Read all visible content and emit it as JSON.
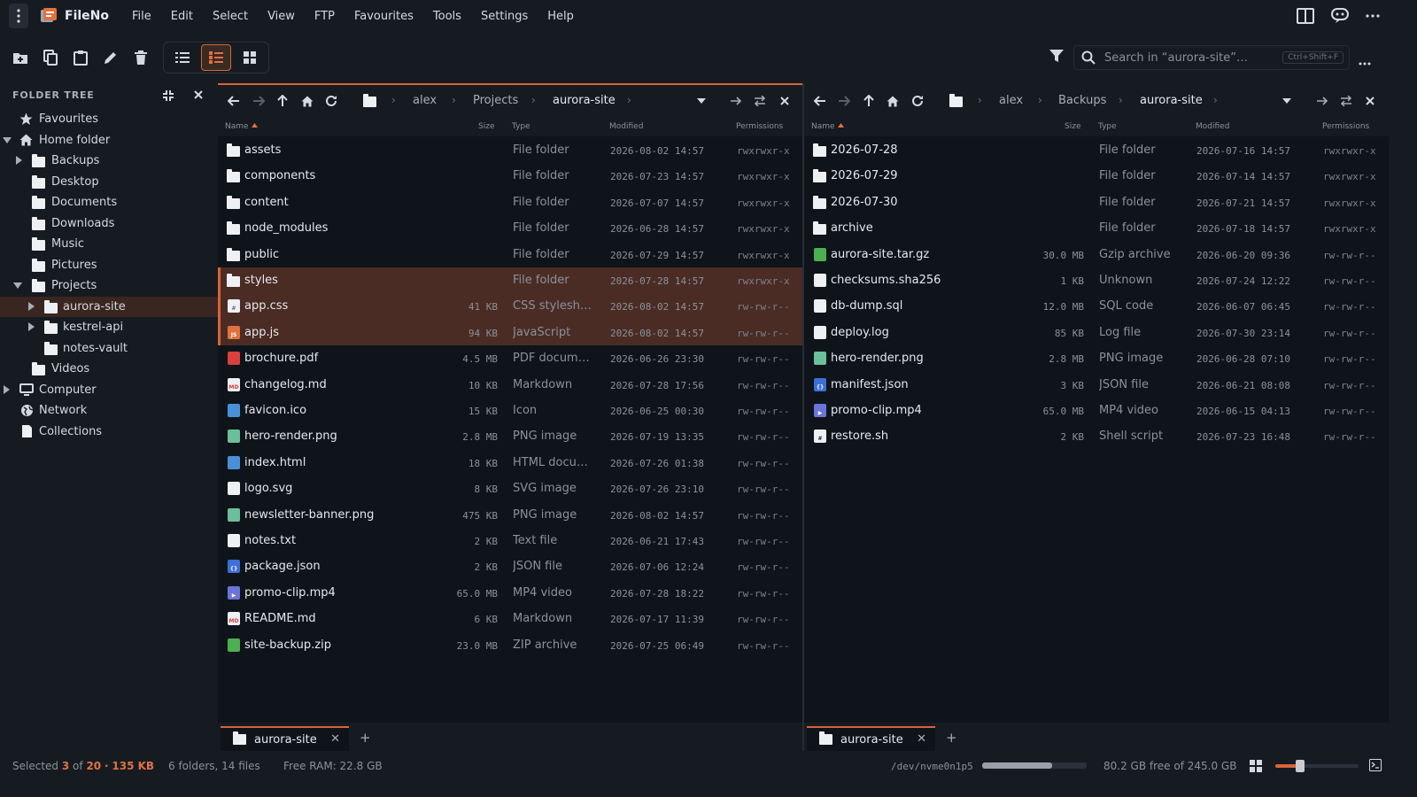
{
  "app": {
    "name": "FileNo",
    "accent": "#d8643a"
  },
  "menu": [
    "File",
    "Edit",
    "Select",
    "View",
    "FTP",
    "Favourites",
    "Tools",
    "Settings",
    "Help"
  ],
  "search": {
    "placeholder": "Search in “aurora-site”…",
    "shortcut": "Ctrl+Shift+F"
  },
  "sidebar": {
    "title": "FOLDER TREE",
    "items": [
      {
        "label": "Favourites",
        "icon": "star-icon"
      },
      {
        "label": "Home folder",
        "icon": "home-icon",
        "expanded": true
      },
      {
        "label": "Backups",
        "icon": "folder-icon"
      },
      {
        "label": "Desktop",
        "icon": "folder-icon"
      },
      {
        "label": "Documents",
        "icon": "folder-icon"
      },
      {
        "label": "Downloads",
        "icon": "folder-icon"
      },
      {
        "label": "Music",
        "icon": "folder-icon"
      },
      {
        "label": "Pictures",
        "icon": "folder-icon"
      },
      {
        "label": "Projects",
        "icon": "folder-icon",
        "expanded": true
      },
      {
        "label": "aurora-site",
        "icon": "folder-icon",
        "selected": true
      },
      {
        "label": "kestrel-api",
        "icon": "folder-icon"
      },
      {
        "label": "notes-vault",
        "icon": "folder-icon"
      },
      {
        "label": "Videos",
        "icon": "folder-icon"
      },
      {
        "label": "Computer",
        "icon": "monitor-icon"
      },
      {
        "label": "Network",
        "icon": "globe-icon"
      },
      {
        "label": "Collections",
        "icon": "document-icon"
      }
    ]
  },
  "columns": {
    "name": "Name",
    "size": "Size",
    "type": "Type",
    "modified": "Modified",
    "permissions": "Permissions"
  },
  "left_pane": {
    "breadcrumb": [
      "alex",
      "Projects",
      "aurora-site"
    ],
    "tab": "aurora-site",
    "files": [
      {
        "name": "assets",
        "size": "",
        "type": "File folder",
        "modified": "2026-08-02 14:57",
        "perm": "rwxrwxr-x",
        "icon": "folder"
      },
      {
        "name": "components",
        "size": "",
        "type": "File folder",
        "modified": "2026-07-23 14:57",
        "perm": "rwxrwxr-x",
        "icon": "folder"
      },
      {
        "name": "content",
        "size": "",
        "type": "File folder",
        "modified": "2026-07-07 14:57",
        "perm": "rwxrwxr-x",
        "icon": "folder"
      },
      {
        "name": "node_modules",
        "size": "",
        "type": "File folder",
        "modified": "2026-06-28 14:57",
        "perm": "rwxrwxr-x",
        "icon": "folder"
      },
      {
        "name": "public",
        "size": "",
        "type": "File folder",
        "modified": "2026-07-29 14:57",
        "perm": "rwxrwxr-x",
        "icon": "folder"
      },
      {
        "name": "styles",
        "size": "",
        "type": "File folder",
        "modified": "2026-07-28 14:57",
        "perm": "rwxrwxr-x",
        "icon": "folder",
        "selected": true
      },
      {
        "name": "app.css",
        "size": "41 KB",
        "type": "CSS stylesheet",
        "modified": "2026-08-02 14:57",
        "perm": "rw-rw-r--",
        "icon": "css",
        "selected": true
      },
      {
        "name": "app.js",
        "size": "94 KB",
        "type": "JavaScript",
        "modified": "2026-08-02 14:57",
        "perm": "rw-rw-r--",
        "icon": "js",
        "selected": true
      },
      {
        "name": "brochure.pdf",
        "size": "4.5 MB",
        "type": "PDF document",
        "modified": "2026-06-26 23:30",
        "perm": "rw-rw-r--",
        "icon": "pdf"
      },
      {
        "name": "changelog.md",
        "size": "10 KB",
        "type": "Markdown",
        "modified": "2026-07-28 17:56",
        "perm": "rw-rw-r--",
        "icon": "md"
      },
      {
        "name": "favicon.ico",
        "size": "15 KB",
        "type": "Icon",
        "modified": "2026-06-25 00:30",
        "perm": "rw-rw-r--",
        "icon": "image"
      },
      {
        "name": "hero-render.png",
        "size": "2.8 MB",
        "type": "PNG image",
        "modified": "2026-07-19 13:35",
        "perm": "rw-rw-r--",
        "icon": "png"
      },
      {
        "name": "index.html",
        "size": "18 KB",
        "type": "HTML docum…",
        "modified": "2026-07-26 01:38",
        "perm": "rw-rw-r--",
        "icon": "html"
      },
      {
        "name": "logo.svg",
        "size": "8 KB",
        "type": "SVG image",
        "modified": "2026-07-26 23:10",
        "perm": "rw-rw-r--",
        "icon": "svg"
      },
      {
        "name": "newsletter-banner.png",
        "size": "475 KB",
        "type": "PNG image",
        "modified": "2026-08-02 14:57",
        "perm": "rw-rw-r--",
        "icon": "png"
      },
      {
        "name": "notes.txt",
        "size": "2 KB",
        "type": "Text file",
        "modified": "2026-06-21 17:43",
        "perm": "rw-rw-r--",
        "icon": "txt"
      },
      {
        "name": "package.json",
        "size": "2 KB",
        "type": "JSON file",
        "modified": "2026-07-06 12:24",
        "perm": "rw-rw-r--",
        "icon": "json"
      },
      {
        "name": "promo-clip.mp4",
        "size": "65.0 MB",
        "type": "MP4 video",
        "modified": "2026-07-28 18:22",
        "perm": "rw-rw-r--",
        "icon": "video"
      },
      {
        "name": "README.md",
        "size": "6 KB",
        "type": "Markdown",
        "modified": "2026-07-17 11:39",
        "perm": "rw-rw-r--",
        "icon": "md"
      },
      {
        "name": "site-backup.zip",
        "size": "23.0 MB",
        "type": "ZIP archive",
        "modified": "2026-07-25 06:49",
        "perm": "rw-rw-r--",
        "icon": "zip"
      }
    ]
  },
  "right_pane": {
    "breadcrumb": [
      "alex",
      "Backups",
      "aurora-site"
    ],
    "tab": "aurora-site",
    "files": [
      {
        "name": "2026-07-28",
        "size": "",
        "type": "File folder",
        "modified": "2026-07-16 14:57",
        "perm": "rwxrwxr-x",
        "icon": "folder"
      },
      {
        "name": "2026-07-29",
        "size": "",
        "type": "File folder",
        "modified": "2026-07-14 14:57",
        "perm": "rwxrwxr-x",
        "icon": "folder"
      },
      {
        "name": "2026-07-30",
        "size": "",
        "type": "File folder",
        "modified": "2026-07-21 14:57",
        "perm": "rwxrwxr-x",
        "icon": "folder"
      },
      {
        "name": "archive",
        "size": "",
        "type": "File folder",
        "modified": "2026-07-18 14:57",
        "perm": "rwxrwxr-x",
        "icon": "folder"
      },
      {
        "name": "aurora-site.tar.gz",
        "size": "30.0 MB",
        "type": "Gzip archive",
        "modified": "2026-06-20 09:36",
        "perm": "rw-rw-r--",
        "icon": "zip"
      },
      {
        "name": "checksums.sha256",
        "size": "1 KB",
        "type": "Unknown",
        "modified": "2026-07-24 12:22",
        "perm": "rw-rw-r--",
        "icon": "txt"
      },
      {
        "name": "db-dump.sql",
        "size": "12.0 MB",
        "type": "SQL code",
        "modified": "2026-06-07 06:45",
        "perm": "rw-rw-r--",
        "icon": "sql"
      },
      {
        "name": "deploy.log",
        "size": "85 KB",
        "type": "Log file",
        "modified": "2026-07-30 23:14",
        "perm": "rw-rw-r--",
        "icon": "txt"
      },
      {
        "name": "hero-render.png",
        "size": "2.8 MB",
        "type": "PNG image",
        "modified": "2026-06-28 07:10",
        "perm": "rw-rw-r--",
        "icon": "png"
      },
      {
        "name": "manifest.json",
        "size": "3 KB",
        "type": "JSON file",
        "modified": "2026-06-21 08:08",
        "perm": "rw-rw-r--",
        "icon": "json"
      },
      {
        "name": "promo-clip.mp4",
        "size": "65.0 MB",
        "type": "MP4 video",
        "modified": "2026-06-15 04:13",
        "perm": "rw-rw-r--",
        "icon": "video"
      },
      {
        "name": "restore.sh",
        "size": "2 KB",
        "type": "Shell script",
        "modified": "2026-07-23 16:48",
        "perm": "rw-rw-r--",
        "icon": "sh"
      }
    ]
  },
  "status": {
    "selected_prefix": "Selected",
    "selected_count": "3",
    "of": "of",
    "total": "20",
    "sep": "·",
    "selected_size": "135 KB",
    "summary": "6 folders, 14 files",
    "ram": "Free RAM: 22.8 GB",
    "device": "/dev/nvme0n1p5",
    "disk_used_fraction": 0.67,
    "disk_free": "80.2 GB free of 245.0 GB",
    "zoom_fraction": 0.3
  }
}
